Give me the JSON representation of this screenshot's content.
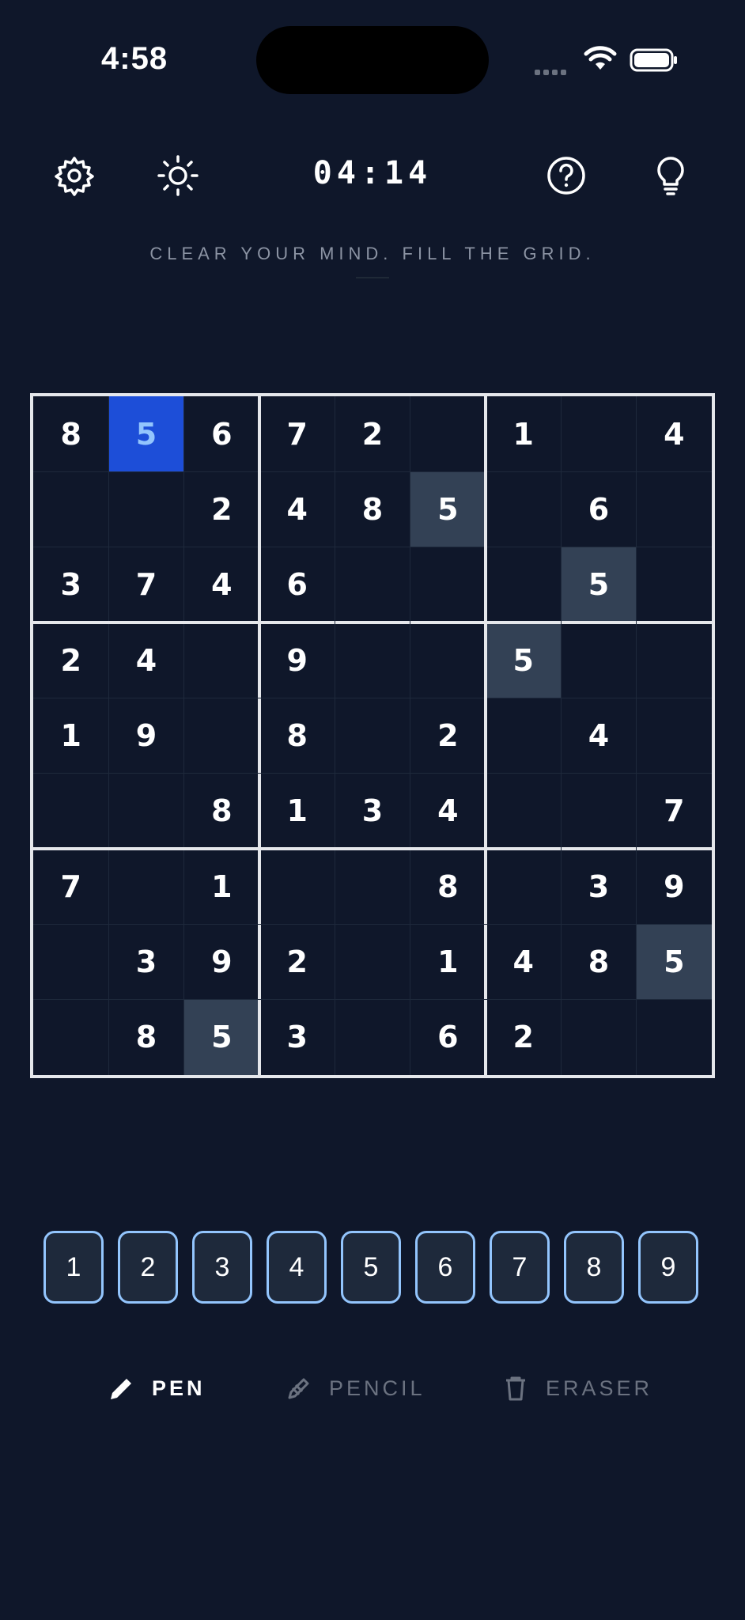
{
  "status_bar": {
    "time": "4:58"
  },
  "toolbar": {
    "timer": "04:14",
    "icons": [
      "gear-icon",
      "sun-icon",
      "help-icon",
      "lightbulb-icon"
    ]
  },
  "tagline": "CLEAR YOUR MIND. FILL THE GRID.",
  "board": {
    "cells": [
      [
        "8",
        "5",
        "6",
        "7",
        "2",
        "",
        "1",
        "",
        "4"
      ],
      [
        "",
        "",
        "2",
        "4",
        "8",
        "5",
        "",
        "6",
        ""
      ],
      [
        "3",
        "7",
        "4",
        "6",
        "",
        "",
        "",
        "5",
        ""
      ],
      [
        "2",
        "4",
        "",
        "9",
        "",
        "",
        "5",
        "",
        ""
      ],
      [
        "1",
        "9",
        "",
        "8",
        "",
        "2",
        "",
        "4",
        ""
      ],
      [
        "",
        "",
        "8",
        "1",
        "3",
        "4",
        "",
        "",
        "7"
      ],
      [
        "7",
        "",
        "1",
        "",
        "",
        "8",
        "",
        "3",
        "9"
      ],
      [
        "",
        "3",
        "9",
        "2",
        "",
        "1",
        "4",
        "8",
        "5"
      ],
      [
        "",
        "8",
        "5",
        "3",
        "",
        "6",
        "2",
        "",
        ""
      ]
    ],
    "selected_cell": [
      0,
      1
    ],
    "selected_value": "5",
    "colors": {
      "selected_bg": "#1d4ed8",
      "selected_text": "#93c5fd",
      "same_value_bg": "#334155",
      "background": "#0f172a"
    }
  },
  "numpad": {
    "digits": [
      "1",
      "2",
      "3",
      "4",
      "5",
      "6",
      "7",
      "8",
      "9"
    ]
  },
  "tools": {
    "pen": {
      "label": "PEN",
      "active": true
    },
    "pencil": {
      "label": "PENCIL",
      "active": false
    },
    "eraser": {
      "label": "ERASER",
      "active": false
    }
  }
}
